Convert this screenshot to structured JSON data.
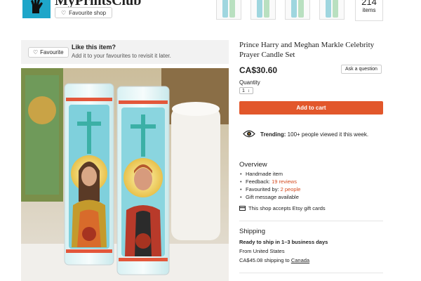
{
  "header": {
    "shop_name": "MyPrintsClub",
    "favourite_shop_label": "Favourite shop",
    "items_count": "214",
    "items_label": "items"
  },
  "like_bar": {
    "favourite_label": "Favourite",
    "title": "Like this item?",
    "subtitle": "Add it to your favourites to revisit it later."
  },
  "product": {
    "title": "Prince Harry and Meghan Markle Celebrity Prayer Candle Set",
    "price": "CA$30.60",
    "ask_label": "Ask a question",
    "quantity_label": "Quantity",
    "quantity_value": "1",
    "add_to_cart_label": "Add to cart",
    "trending_bold": "Trending:",
    "trending_text": " 100+ people viewed it this week."
  },
  "overview": {
    "title": "Overview",
    "handmade": "Handmade item",
    "feedback_label": "Feedback: ",
    "feedback_link": "19 reviews",
    "favourited_label": "Favourited by: ",
    "favourited_link": "2 people",
    "gift": "Gift message available",
    "gift_cards": "This shop accepts Etsy gift cards"
  },
  "shipping": {
    "title": "Shipping",
    "ready": "Ready to ship in 1–3 business days",
    "from": "From United States",
    "cost_text": "CA$45.08 shipping to ",
    "cost_link": "Canada"
  },
  "colors": {
    "accent": "#e2572b",
    "link": "#d44a1f",
    "logo_bg": "#1ea6c9"
  }
}
